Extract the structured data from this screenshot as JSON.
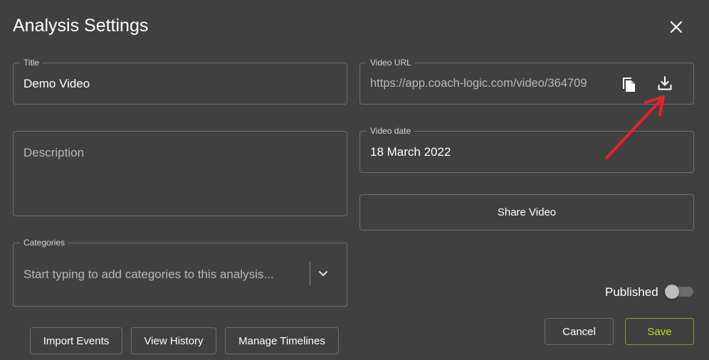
{
  "dialog": {
    "title": "Analysis Settings"
  },
  "fields": {
    "title": {
      "label": "Title",
      "value": "Demo Video"
    },
    "description": {
      "placeholder": "Description"
    },
    "categories": {
      "label": "Categories",
      "placeholder": "Start typing to add categories to this analysis..."
    },
    "video_url": {
      "label": "Video URL",
      "value": "https://app.coach-logic.com/video/364709"
    },
    "video_date": {
      "label": "Video date",
      "value": "18 March 2022"
    }
  },
  "buttons": {
    "share_video": "Share Video",
    "import_events": "Import Events",
    "view_history": "View History",
    "manage_timelines": "Manage Timelines",
    "cancel": "Cancel",
    "save": "Save"
  },
  "published": {
    "label": "Published",
    "on": false
  },
  "icons": {
    "close": "close-icon",
    "copy": "copy-icon",
    "download": "download-icon",
    "dropdown": "chevron-down-icon"
  },
  "colors": {
    "background": "#404040",
    "accent": "#c4d82c",
    "annotation_arrow": "#e8232f"
  }
}
